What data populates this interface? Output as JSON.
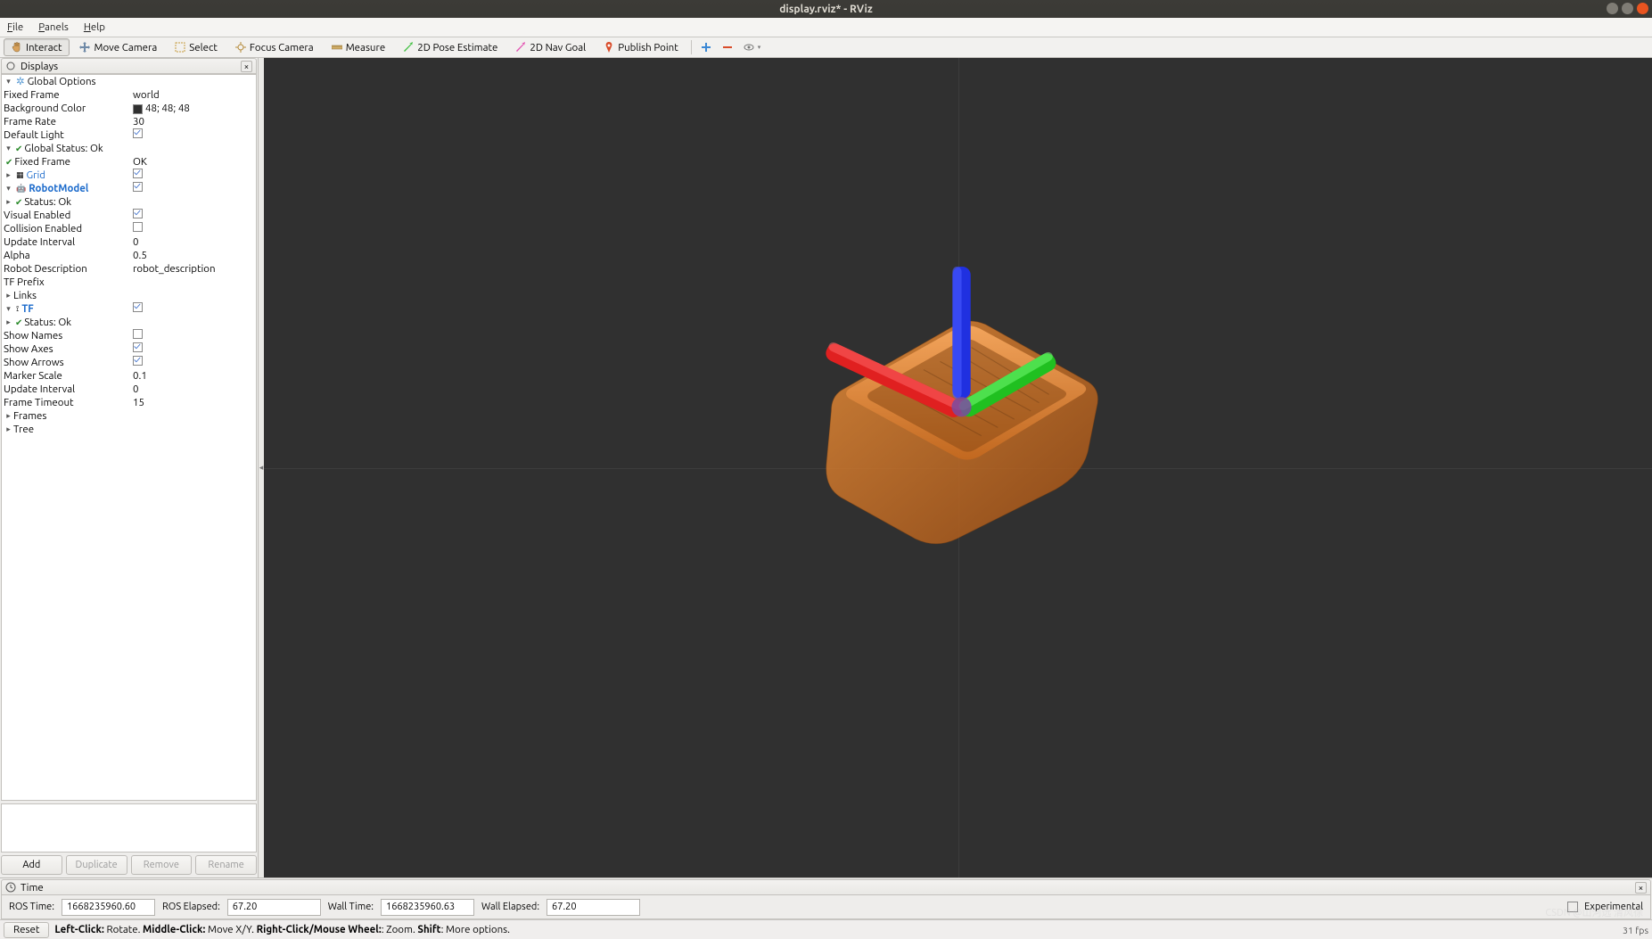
{
  "titlebar": {
    "title": "display.rviz* - RViz"
  },
  "menubar": {
    "file": "File",
    "panels": "Panels",
    "help": "Help"
  },
  "toolbar": {
    "interact": "Interact",
    "move_camera": "Move Camera",
    "select": "Select",
    "focus_camera": "Focus Camera",
    "measure": "Measure",
    "pose_estimate": "2D Pose Estimate",
    "nav_goal": "2D Nav Goal",
    "publish_point": "Publish Point"
  },
  "displays_panel": {
    "title": "Displays",
    "global_options": "Global Options",
    "fixed_frame": {
      "label": "Fixed Frame",
      "value": "world"
    },
    "background_color": {
      "label": "Background Color",
      "value": "48; 48; 48",
      "hex": "#303030"
    },
    "frame_rate": {
      "label": "Frame Rate",
      "value": "30"
    },
    "default_light": {
      "label": "Default Light",
      "checked": true
    },
    "global_status": {
      "label": "Global Status: Ok"
    },
    "global_status_child": {
      "label": "Fixed Frame",
      "value": "OK"
    },
    "grid": {
      "label": "Grid",
      "checked": true
    },
    "robot_model": {
      "label": "RobotModel",
      "checked": true,
      "status": "Status: Ok",
      "visual_enabled": {
        "label": "Visual Enabled",
        "checked": true
      },
      "collision_enabled": {
        "label": "Collision Enabled",
        "checked": false
      },
      "update_interval": {
        "label": "Update Interval",
        "value": "0"
      },
      "alpha": {
        "label": "Alpha",
        "value": "0.5"
      },
      "robot_description": {
        "label": "Robot Description",
        "value": "robot_description"
      },
      "tf_prefix": {
        "label": "TF Prefix",
        "value": ""
      },
      "links": {
        "label": "Links"
      }
    },
    "tf": {
      "label": "TF",
      "checked": true,
      "status": "Status: Ok",
      "show_names": {
        "label": "Show Names",
        "checked": false
      },
      "show_axes": {
        "label": "Show Axes",
        "checked": true
      },
      "show_arrows": {
        "label": "Show Arrows",
        "checked": true
      },
      "marker_scale": {
        "label": "Marker Scale",
        "value": "0.1"
      },
      "update_interval": {
        "label": "Update Interval",
        "value": "0"
      },
      "frame_timeout": {
        "label": "Frame Timeout",
        "value": "15"
      },
      "frames": {
        "label": "Frames"
      },
      "tree": {
        "label": "Tree"
      }
    },
    "buttons": {
      "add": "Add",
      "duplicate": "Duplicate",
      "remove": "Remove",
      "rename": "Rename"
    }
  },
  "time_panel": {
    "title": "Time",
    "ros_time": {
      "label": "ROS Time:",
      "value": "1668235960.60"
    },
    "ros_elapsed": {
      "label": "ROS Elapsed:",
      "value": "67.20"
    },
    "wall_time": {
      "label": "Wall Time:",
      "value": "1668235960.63"
    },
    "wall_elapsed": {
      "label": "Wall Elapsed:",
      "value": "67.20"
    },
    "experimental": "Experimental"
  },
  "statusbar": {
    "reset": "Reset",
    "help_html": "Left-Click: Rotate. Middle-Click: Move X/Y. Right-Click/Mouse Wheel:: Zoom. Shift: More options.",
    "fps": "31 fps"
  },
  "watermark": "CSDN @山河远  清风徐",
  "colors": {
    "axis_x": "#e02020",
    "axis_y": "#20c020",
    "axis_z": "#2030e0",
    "model": "#d97a1a"
  }
}
